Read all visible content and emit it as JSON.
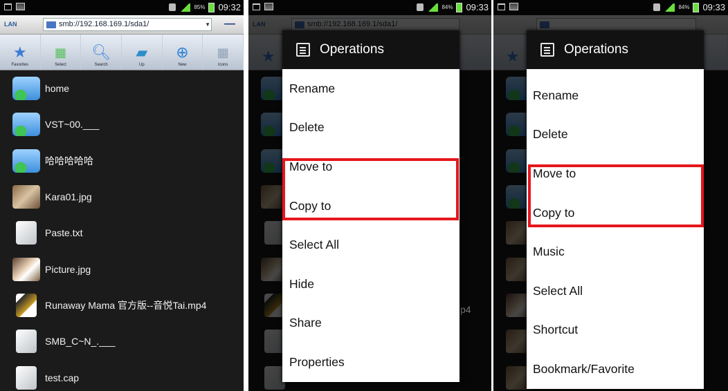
{
  "statusbar": [
    {
      "battery_pct": "85%",
      "time": "09:32"
    },
    {
      "battery_pct": "84%",
      "time": "09:33"
    },
    {
      "battery_pct": "84%",
      "time": "09:33"
    }
  ],
  "address": {
    "network_label": "LAN",
    "path": "smb://192.168.169.1/sda1/"
  },
  "toolbar": [
    {
      "label": "Favorites",
      "icon": "star-icon"
    },
    {
      "label": "Select",
      "icon": "select-grid-icon"
    },
    {
      "label": "Search",
      "icon": "search-icon"
    },
    {
      "label": "Up",
      "icon": "folder-up-icon"
    },
    {
      "label": "New",
      "icon": "add-icon"
    },
    {
      "label": "Icons",
      "icon": "view-grid-icon"
    }
  ],
  "files": [
    {
      "name": "home",
      "type": "folder"
    },
    {
      "name": "VST~00.___",
      "type": "folder"
    },
    {
      "name": "哈哈哈哈哈",
      "type": "folder"
    },
    {
      "name": "Kara01.jpg",
      "type": "image"
    },
    {
      "name": "Paste.txt",
      "type": "text"
    },
    {
      "name": "Picture.jpg",
      "type": "photo"
    },
    {
      "name": "Runaway Mama 官方版--音悦Tai.mp4",
      "type": "video"
    },
    {
      "name": "SMB_C~N_.___",
      "type": "text"
    },
    {
      "name": "test.cap",
      "type": "text"
    }
  ],
  "dialog2": {
    "title": "Operations",
    "items": [
      "Rename",
      "Delete",
      "Move to",
      "Copy to",
      "Select All",
      "Hide",
      "Share",
      "Properties"
    ]
  },
  "dialog3": {
    "title": "Operations",
    "items": [
      "Rename",
      "Delete",
      "Move to",
      "Copy to",
      "Music",
      "Select All",
      "Shortcut",
      "Bookmark/Favorite"
    ]
  },
  "peek_text": "p4",
  "colors": {
    "highlight": "#e5161c",
    "dialog_header": "#121212",
    "background": "#1b1b1b"
  }
}
